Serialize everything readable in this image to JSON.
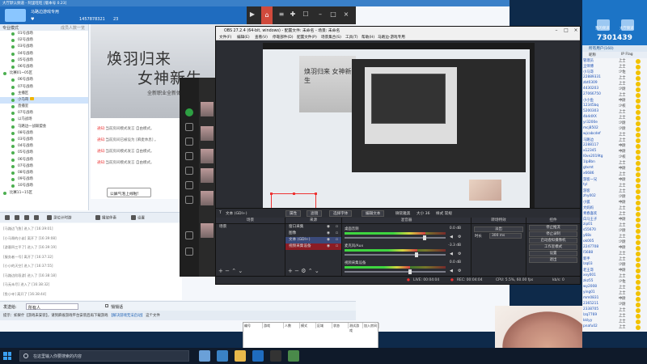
{
  "client": {
    "title": "大厅默认频道 - 阿里旺旺 [版本号 0.23]",
    "user_name": "马路边游戏专用",
    "user_id": "1457878321",
    "count": "23",
    "tree_header": "专业模式",
    "tree_header_right": "成员人数一览",
    "rooms": [
      {
        "label": "01号战场",
        "level": 2
      },
      {
        "label": "02号战场",
        "level": 2
      },
      {
        "label": "03号战场",
        "level": 2
      },
      {
        "label": "04号战场",
        "level": 2
      },
      {
        "label": "05号战场",
        "level": 2
      },
      {
        "label": "06号战场",
        "level": 2
      },
      {
        "label": "比赛01~05区",
        "level": 1
      },
      {
        "label": "06号战场",
        "level": 2
      },
      {
        "label": "07号战场",
        "level": 2
      },
      {
        "label": "主播区",
        "level": 2
      },
      {
        "label": "小马哥",
        "level": 2,
        "selected": true
      },
      {
        "label": "直播室",
        "level": 2
      },
      {
        "label": "07号战场",
        "level": 2
      },
      {
        "label": "以马战场",
        "level": 2
      },
      {
        "label": "马路边一战联盟会",
        "level": 2
      },
      {
        "label": "08号战场",
        "level": 2
      },
      {
        "label": "03号战场",
        "level": 2
      },
      {
        "label": "04号战场",
        "level": 2
      },
      {
        "label": "05号战场",
        "level": 2
      },
      {
        "label": "06号战场",
        "level": 2
      },
      {
        "label": "07号战场",
        "level": 2
      },
      {
        "label": "08号战场",
        "level": 2
      },
      {
        "label": "09号战场",
        "level": 2
      },
      {
        "label": "10号战场",
        "level": 2
      },
      {
        "label": "比赛11~15区",
        "level": 1
      }
    ],
    "banner": {
      "line1": "焕羽归来",
      "line2": "女神新生",
      "line3": "全新职业全新体验"
    },
    "system_msgs": [
      {
        "tag": "通知:",
        "text": "当前房间模式发言 自由模式。"
      },
      {
        "tag": "通知:",
        "text": "当前房间已被设为 [麻麦休息] 。"
      },
      {
        "tag": "通知:",
        "text": "当前房间模式发言 自由模式。"
      },
      {
        "tag": "通知:",
        "text": "当前房间模式发言 自由模式。"
      }
    ],
    "speaker_popup": "公屏气泡上线啦!",
    "toolbar": {
      "record": "录位计时游",
      "music": "播放伴奏",
      "setting": "设置"
    },
    "log_lines": [
      "[马路边飞鱼] 进入了 [16:39:01]",
      "[小马哥的小弟] 离开了 [16:39:08]",
      "[游客四三平了] 进入了 [16:39:19]",
      "[服务者一号] 离开了 [16:37:32]",
      "[小小的天空] 进入了 [16:37:55]",
      "[马路边阶段游] 进入了 [16:38:18]",
      "[马无未尽] 进入了 [16:38:32]",
      "[鱼小寺] 离开了 [16:38:44]"
    ],
    "send_label": "发送给:",
    "send_target": "所有人",
    "private_chat": "悄悄话",
    "hint_prefix": "提示：如果什【游戏未安装】，请到麻雀游戏平台安装后再下载游戏",
    "hint_link": "【解决游戏无法启动】",
    "hint_suffix": "这个文件",
    "table_headers": [
      "编号",
      "游戏",
      "人数",
      "模式",
      "区域",
      "状态",
      "测试游戏",
      "加入房间"
    ]
  },
  "obs": {
    "title": "OBS 27.2.4 (64-bit, windows) - 配置文件: 未命名 - 场景: 未命名",
    "menu": [
      "文件(F)",
      "编辑(E)",
      "查看(V)",
      "停靠部件(D)",
      "配置文件(P)",
      "场景集合(S)",
      "工具(T)",
      "帮助(H)",
      "马路边-游戏专用"
    ],
    "preview_banner": "焕羽归来 女神新生",
    "source_bar": {
      "source": "文本 (GDI+)",
      "properties": "属性",
      "filters": "滤镜",
      "select_font": "选择字体",
      "edit_text": "编辑文本",
      "font_name": "微软雅黑",
      "font_size": "大小 36",
      "font_style": "样式 常规"
    },
    "docks": {
      "scenes": "场景",
      "sources": "来源",
      "mixer": "混音器",
      "transitions": "转场特效",
      "controls": "控件"
    },
    "scenes": [
      "场景"
    ],
    "sources": [
      {
        "label": "窗口采集",
        "state": "normal"
      },
      {
        "label": "图像",
        "state": "normal"
      },
      {
        "label": "文本 (GDI+)",
        "state": "selected"
      },
      {
        "label": "视频采集设备",
        "state": "highlight"
      }
    ],
    "mixer": [
      {
        "name": "桌面音频",
        "db": "0.0 dB",
        "level": 0.8
      },
      {
        "name": "麦克风/Aux",
        "db": "-3.3 dB",
        "level": 0.72
      },
      {
        "name": "视频采集设备",
        "db": "0.0 dB",
        "level": 0.65
      }
    ],
    "transition": {
      "type": "淡出",
      "duration_label": "时长",
      "duration": "300 ms"
    },
    "controls": [
      "停止推流",
      "停止录制",
      "启动虚拟摄像机",
      "工作室模式",
      "设置",
      "退出"
    ],
    "status": {
      "live": "LIVE: 00:04:04",
      "rec": "REC: 00:04:04",
      "cpu": "CPU: 5.5%, 60.00 fps",
      "kbs": "kb/s: 0"
    }
  },
  "qq": {
    "big_text": "7301439",
    "btn1": "我的频道",
    "btn2": "大厅频道",
    "tab": "所有用户(160)",
    "col_name": "昵称",
    "col_status": "IP Flag",
    "users": [
      {
        "name": "管理员",
        "status": "上士"
      },
      {
        "name": "王师傅",
        "status": "上士"
      },
      {
        "name": "小马哥",
        "status": "少佐"
      },
      {
        "name": "22889331",
        "status": "上士"
      },
      {
        "name": "zbt0309",
        "status": "上士"
      },
      {
        "name": "4430203",
        "status": "少尉"
      },
      {
        "name": "27066750",
        "status": "上士"
      },
      {
        "name": "小小鱼",
        "status": "中尉"
      },
      {
        "name": "12345bq",
        "status": "少校"
      },
      {
        "name": "5200303",
        "status": "上士"
      },
      {
        "name": "4b4dXX",
        "status": "上士"
      },
      {
        "name": "yr3200e",
        "status": "少尉"
      },
      {
        "name": "mcj8502",
        "status": "少尉"
      },
      {
        "name": "wjcabcdef",
        "status": "上士"
      },
      {
        "name": "马路边",
        "status": "上士"
      },
      {
        "name": "2288117",
        "status": "中尉"
      },
      {
        "name": "x12345",
        "status": "中尉"
      },
      {
        "name": "l0ve2019tg",
        "status": "少校"
      },
      {
        "name": "1lp8bn",
        "status": "上士"
      },
      {
        "name": "gtxmt",
        "status": "中尉"
      },
      {
        "name": "x6686",
        "status": "上士"
      },
      {
        "name": "游客一兄",
        "status": "中尉"
      },
      {
        "name": "tyl",
        "status": "上士"
      },
      {
        "name": "游客",
        "status": "上士"
      },
      {
        "name": "zhy002",
        "status": "少尉"
      },
      {
        "name": "小狐",
        "status": "中尉"
      },
      {
        "name": "大妈妈",
        "status": "上士"
      },
      {
        "name": "青春喜欢",
        "status": "上士"
      },
      {
        "name": "白马王子",
        "status": "中尉"
      },
      {
        "name": "zip01",
        "status": "上士"
      },
      {
        "name": "s55670",
        "status": "少尉"
      },
      {
        "name": "y68s",
        "status": "上士"
      },
      {
        "name": "ok005",
        "status": "少尉"
      },
      {
        "name": "2247708",
        "status": "中尉"
      },
      {
        "name": "l5688",
        "status": "上士"
      },
      {
        "name": "新手",
        "status": "上士"
      },
      {
        "name": "lzq03",
        "status": "少尉"
      },
      {
        "name": "老王哥",
        "status": "中尉"
      },
      {
        "name": "xxy001",
        "status": "上士"
      },
      {
        "name": "zkz55",
        "status": "少佐"
      },
      {
        "name": "wy2008",
        "status": "上士"
      },
      {
        "name": "ying01",
        "status": "上士"
      },
      {
        "name": "mm0831",
        "status": "中尉"
      },
      {
        "name": "2365211",
        "status": "少尉"
      },
      {
        "name": "2338705",
        "status": "上士"
      },
      {
        "name": "lzq7769",
        "status": "上士"
      },
      {
        "name": "kklyy",
        "status": "上士"
      },
      {
        "name": "pnafu02",
        "status": "上士"
      }
    ]
  },
  "taskbar": {
    "search_placeholder": "在这里输入你要搜索的内容"
  },
  "colors": {
    "client_header": "#1f6cbf",
    "obs_bg": "#2b2d33",
    "source_selected": "#3b4a7a",
    "source_highlight": "#8b1c24",
    "live_red": "#e33333"
  }
}
